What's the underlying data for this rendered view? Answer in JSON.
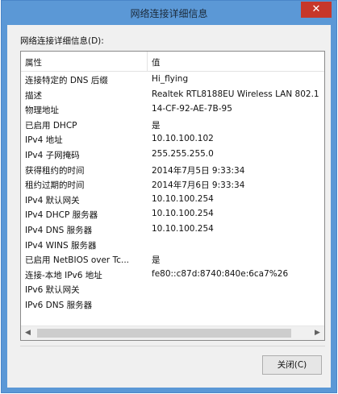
{
  "window": {
    "title": "网络连接详细信息",
    "close_glyph": "✕"
  },
  "caption": "网络连接详细信息(D):",
  "list": {
    "columns": [
      "属性",
      "值"
    ],
    "rows": [
      {
        "prop": "连接特定的 DNS 后缀",
        "val": "Hi_flying"
      },
      {
        "prop": "描述",
        "val": "Realtek RTL8188EU Wireless LAN 802.1"
      },
      {
        "prop": "物理地址",
        "val": "14-CF-92-AE-7B-95"
      },
      {
        "prop": "已启用 DHCP",
        "val": "是"
      },
      {
        "prop": "IPv4 地址",
        "val": "10.10.100.102"
      },
      {
        "prop": "IPv4 子网掩码",
        "val": "255.255.255.0"
      },
      {
        "prop": "获得租约的时间",
        "val": "2014年7月5日 9:33:34"
      },
      {
        "prop": "租约过期的时间",
        "val": "2014年7月6日 9:33:34"
      },
      {
        "prop": "IPv4 默认网关",
        "val": "10.10.100.254"
      },
      {
        "prop": "IPv4 DHCP 服务器",
        "val": "10.10.100.254"
      },
      {
        "prop": "IPv4 DNS 服务器",
        "val": "10.10.100.254"
      },
      {
        "prop": "IPv4 WINS 服务器",
        "val": ""
      },
      {
        "prop": "已启用 NetBIOS over Tc...",
        "val": "是"
      },
      {
        "prop": "连接-本地 IPv6 地址",
        "val": "fe80::c87d:8740:840e:6ca7%26"
      },
      {
        "prop": "IPv6 默认网关",
        "val": ""
      },
      {
        "prop": "IPv6 DNS 服务器",
        "val": ""
      }
    ]
  },
  "scrollbar": {
    "left_arrow": "◀",
    "right_arrow": "▶"
  },
  "buttons": {
    "close_label": "关闭(C)"
  }
}
